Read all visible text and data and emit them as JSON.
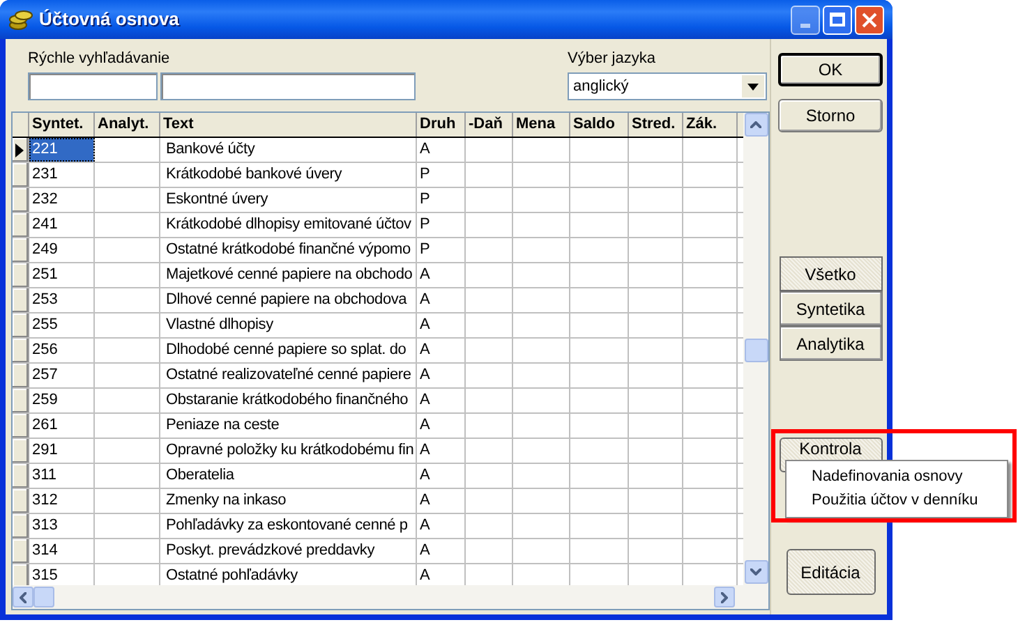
{
  "window": {
    "title": "Účtovná osnova"
  },
  "quick_search": {
    "label": "Rýchle vyhľadávanie"
  },
  "language": {
    "label": "Výber jazyka",
    "value": "anglický"
  },
  "buttons": {
    "ok": "OK",
    "cancel": "Storno",
    "check": "Kontrola",
    "edit": "Editácia"
  },
  "filters": [
    {
      "label": "Všetko",
      "selected": true
    },
    {
      "label": "Syntetika",
      "selected": false
    },
    {
      "label": "Analytika",
      "selected": false
    }
  ],
  "table": {
    "columns": [
      "Syntet.",
      "Analyt.",
      "Text",
      "Druh",
      "-Daň",
      "Mena",
      "Saldo",
      "Stred.",
      "Zák."
    ],
    "rows": [
      {
        "syntet": "221",
        "text": "Bankové účty",
        "druh": "A",
        "selected": true
      },
      {
        "syntet": "231",
        "text": "Krátkodobé bankové úvery",
        "druh": "P",
        "selected": false
      },
      {
        "syntet": "232",
        "text": "Eskontné úvery",
        "druh": "P",
        "selected": false
      },
      {
        "syntet": "241",
        "text": "Krátkodobé dlhopisy emitované účtov",
        "druh": "P",
        "selected": false
      },
      {
        "syntet": "249",
        "text": "Ostatné krátkodobé finančné výpomo",
        "druh": "P",
        "selected": false
      },
      {
        "syntet": "251",
        "text": "Majetkové cenné papiere na obchodo",
        "druh": "A",
        "selected": false
      },
      {
        "syntet": "253",
        "text": "Dlhové cenné papiere na obchodova",
        "druh": "A",
        "selected": false
      },
      {
        "syntet": "255",
        "text": "Vlastné dlhopisy",
        "druh": "A",
        "selected": false
      },
      {
        "syntet": "256",
        "text": "Dlhodobé cenné papiere so splat. do",
        "druh": "A",
        "selected": false
      },
      {
        "syntet": "257",
        "text": "Ostatné realizovateľné cenné papiere",
        "druh": "A",
        "selected": false
      },
      {
        "syntet": "259",
        "text": "Obstaranie krátkodobého finančného",
        "druh": "A",
        "selected": false
      },
      {
        "syntet": "261",
        "text": "Peniaze na ceste",
        "druh": "A",
        "selected": false
      },
      {
        "syntet": "291",
        "text": "Opravné položky ku krátkodobému fin",
        "druh": "A",
        "selected": false
      },
      {
        "syntet": "311",
        "text": "Oberatelia",
        "druh": "A",
        "selected": false
      },
      {
        "syntet": "312",
        "text": "Zmenky na inkaso",
        "druh": "A",
        "selected": false
      },
      {
        "syntet": "313",
        "text": "Pohľadávky za eskontované cenné p",
        "druh": "A",
        "selected": false
      },
      {
        "syntet": "314",
        "text": "Poskyt. prevádzkové preddavky",
        "druh": "A",
        "selected": false
      },
      {
        "syntet": "315",
        "text": "Ostatné pohľadávky",
        "druh": "A",
        "selected": false
      }
    ]
  },
  "popup_menu": {
    "items": [
      "Nadefinovania osnovy",
      "Použitia účtov v denníku"
    ]
  }
}
